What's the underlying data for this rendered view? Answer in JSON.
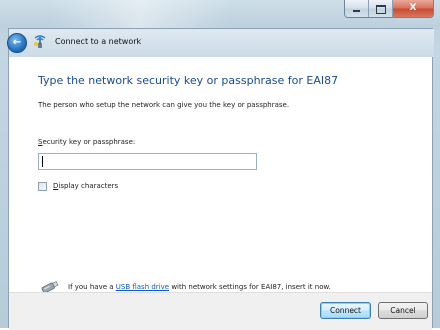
{
  "window": {
    "title": "Connect to a network",
    "caption_buttons": {
      "minimize": "–",
      "maximize": "□",
      "close": "X"
    }
  },
  "nav": {
    "back_icon": "back-arrow-icon",
    "app_icon": "network-icon",
    "title": "Connect to a network"
  },
  "content": {
    "heading": "Type the network security key or passphrase for EAI87",
    "description": "The person who setup the network can give you the key or passphrase.",
    "key_field": {
      "label_mnemonic": "S",
      "label_rest": "ecurity key or passphrase:",
      "value": "",
      "placeholder": ""
    },
    "display_characters": {
      "checked": false,
      "label_mnemonic": "D",
      "label_rest": "isplay characters"
    },
    "usb": {
      "icon": "usb-flash-drive-icon",
      "text_before": "If you have a ",
      "link": "USB flash drive",
      "text_after": " with network settings for EAI87, insert it now."
    }
  },
  "footer": {
    "connect_label": "Connect",
    "cancel_label": "Cancel"
  },
  "colors": {
    "heading": "#1a4b8e",
    "link": "#0f58c8",
    "close_button": "#c64a32",
    "default_button_border": "#3c7fb1"
  }
}
